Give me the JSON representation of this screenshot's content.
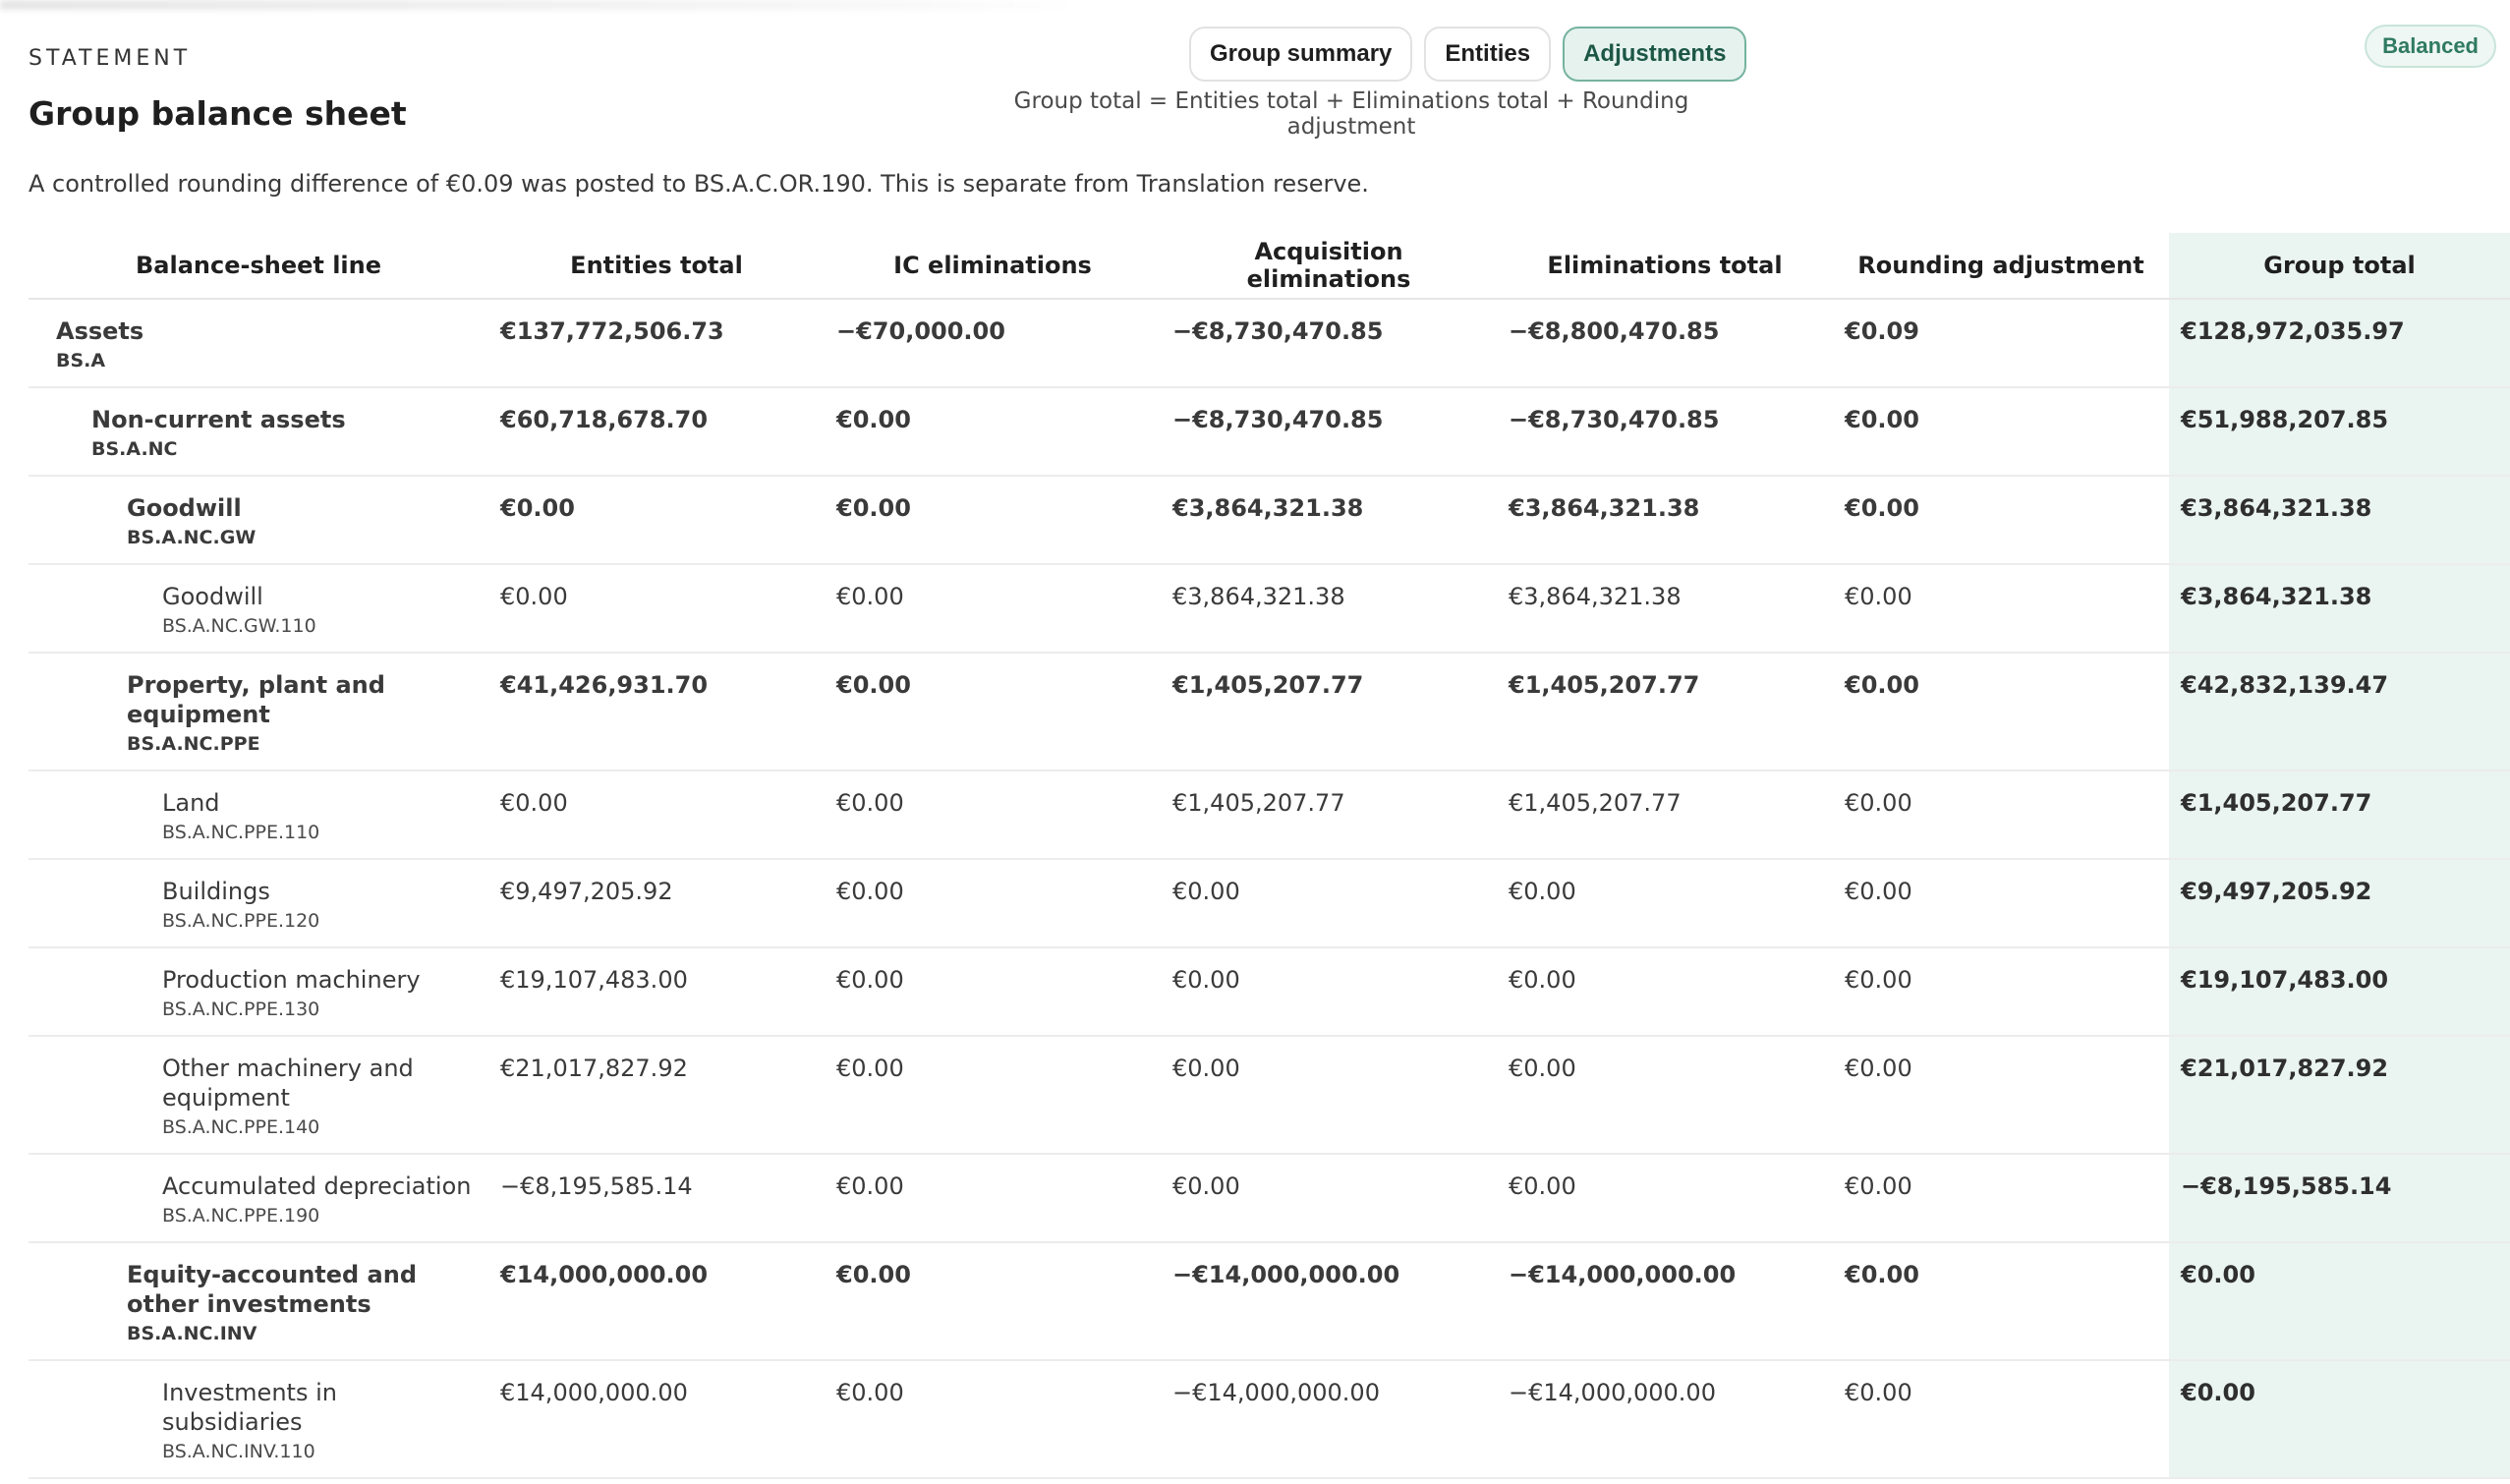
{
  "header": {
    "eyebrow": "STATEMENT",
    "title": "Group balance sheet",
    "formula": "Group total = Entities total + Eliminations total + Rounding adjustment",
    "status_badge": "Balanced",
    "note": "A controlled rounding difference of €0.09 was posted to BS.A.C.OR.190. This is separate from Translation reserve."
  },
  "tabs": [
    {
      "label": "Group summary",
      "active": false
    },
    {
      "label": "Entities",
      "active": false
    },
    {
      "label": "Adjustments",
      "active": true
    }
  ],
  "table": {
    "columns": [
      "Balance-sheet line",
      "Entities total",
      "IC eliminations",
      "Acquisition eliminations",
      "Eliminations total",
      "Rounding adjustment",
      "Group total"
    ],
    "rows": [
      {
        "name": "Assets",
        "code": "BS.A",
        "level": 0,
        "bold": true,
        "values": [
          "€137,772,506.73",
          "−€70,000.00",
          "−€8,730,470.85",
          "−€8,800,470.85",
          "€0.09",
          "€128,972,035.97"
        ]
      },
      {
        "name": "Non-current assets",
        "code": "BS.A.NC",
        "level": 1,
        "bold": true,
        "values": [
          "€60,718,678.70",
          "€0.00",
          "−€8,730,470.85",
          "−€8,730,470.85",
          "€0.00",
          "€51,988,207.85"
        ]
      },
      {
        "name": "Goodwill",
        "code": "BS.A.NC.GW",
        "level": 2,
        "bold": true,
        "values": [
          "€0.00",
          "€0.00",
          "€3,864,321.38",
          "€3,864,321.38",
          "€0.00",
          "€3,864,321.38"
        ]
      },
      {
        "name": "Goodwill",
        "code": "BS.A.NC.GW.110",
        "level": 3,
        "bold": false,
        "values": [
          "€0.00",
          "€0.00",
          "€3,864,321.38",
          "€3,864,321.38",
          "€0.00",
          "€3,864,321.38"
        ]
      },
      {
        "name": "Property, plant and equipment",
        "code": "BS.A.NC.PPE",
        "level": 2,
        "bold": true,
        "values": [
          "€41,426,931.70",
          "€0.00",
          "€1,405,207.77",
          "€1,405,207.77",
          "€0.00",
          "€42,832,139.47"
        ]
      },
      {
        "name": "Land",
        "code": "BS.A.NC.PPE.110",
        "level": 3,
        "bold": false,
        "values": [
          "€0.00",
          "€0.00",
          "€1,405,207.77",
          "€1,405,207.77",
          "€0.00",
          "€1,405,207.77"
        ]
      },
      {
        "name": "Buildings",
        "code": "BS.A.NC.PPE.120",
        "level": 3,
        "bold": false,
        "values": [
          "€9,497,205.92",
          "€0.00",
          "€0.00",
          "€0.00",
          "€0.00",
          "€9,497,205.92"
        ]
      },
      {
        "name": "Production machinery",
        "code": "BS.A.NC.PPE.130",
        "level": 3,
        "bold": false,
        "values": [
          "€19,107,483.00",
          "€0.00",
          "€0.00",
          "€0.00",
          "€0.00",
          "€19,107,483.00"
        ]
      },
      {
        "name": "Other machinery and equipment",
        "code": "BS.A.NC.PPE.140",
        "level": 3,
        "bold": false,
        "values": [
          "€21,017,827.92",
          "€0.00",
          "€0.00",
          "€0.00",
          "€0.00",
          "€21,017,827.92"
        ]
      },
      {
        "name": "Accumulated depreciation",
        "code": "BS.A.NC.PPE.190",
        "level": 3,
        "bold": false,
        "values": [
          "−€8,195,585.14",
          "€0.00",
          "€0.00",
          "€0.00",
          "€0.00",
          "−€8,195,585.14"
        ]
      },
      {
        "name": "Equity-accounted and other investments",
        "code": "BS.A.NC.INV",
        "level": 2,
        "bold": true,
        "values": [
          "€14,000,000.00",
          "€0.00",
          "−€14,000,000.00",
          "−€14,000,000.00",
          "€0.00",
          "€0.00"
        ]
      },
      {
        "name": "Investments in subsidiaries",
        "code": "BS.A.NC.INV.110",
        "level": 3,
        "bold": false,
        "values": [
          "€14,000,000.00",
          "€0.00",
          "−€14,000,000.00",
          "−€14,000,000.00",
          "€0.00",
          "€0.00"
        ]
      }
    ]
  }
}
